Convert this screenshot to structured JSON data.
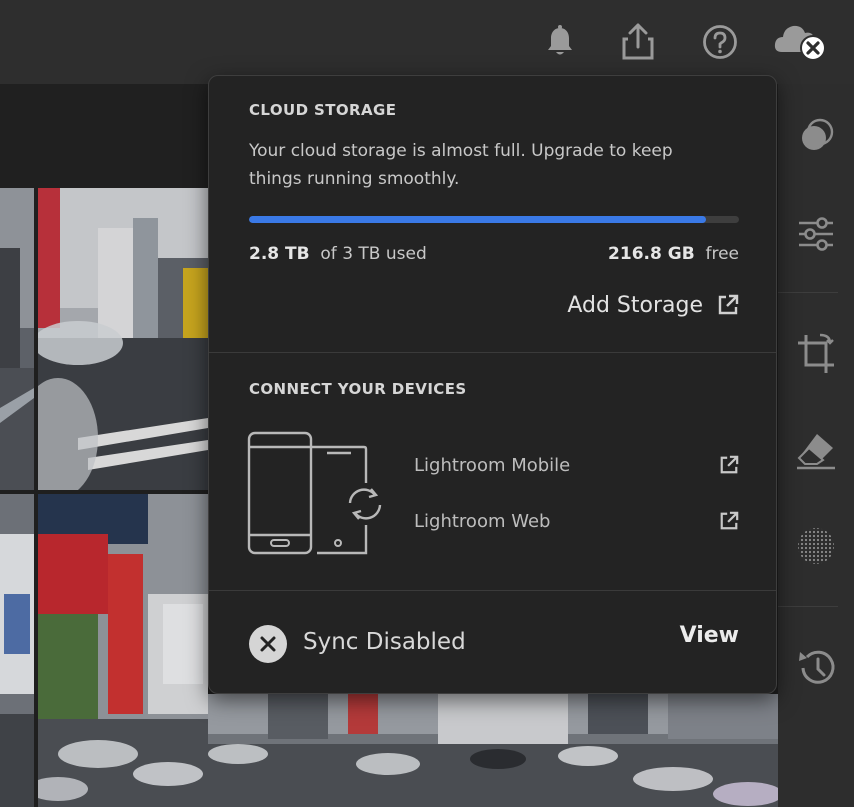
{
  "toolbar": {
    "icons": [
      "bell-icon",
      "share-icon",
      "help-icon",
      "cloud-error-icon"
    ]
  },
  "right_panel": {
    "icons": [
      "mask-icon",
      "sliders-icon",
      "crop-icon",
      "eraser-icon",
      "dots-circle-icon",
      "history-icon"
    ]
  },
  "cloud_storage": {
    "heading": "CLOUD STORAGE",
    "message": "Your cloud storage is almost full. Upgrade to keep things running smoothly.",
    "used_value": "2.8 TB",
    "used_suffix": "of 3 TB used",
    "free_value": "216.8 GB",
    "free_suffix": "free",
    "usage_fraction": 0.933,
    "add_storage_label": "Add Storage"
  },
  "devices": {
    "heading": "CONNECT YOUR DEVICES",
    "links": [
      {
        "label": "Lightroom Mobile"
      },
      {
        "label": "Lightroom Web"
      }
    ]
  },
  "sync": {
    "status": "Sync Disabled",
    "view_label": "View"
  },
  "colors": {
    "accent": "#3a79e6",
    "popover_bg": "#232323",
    "topbar_bg": "#2e2e2e"
  }
}
